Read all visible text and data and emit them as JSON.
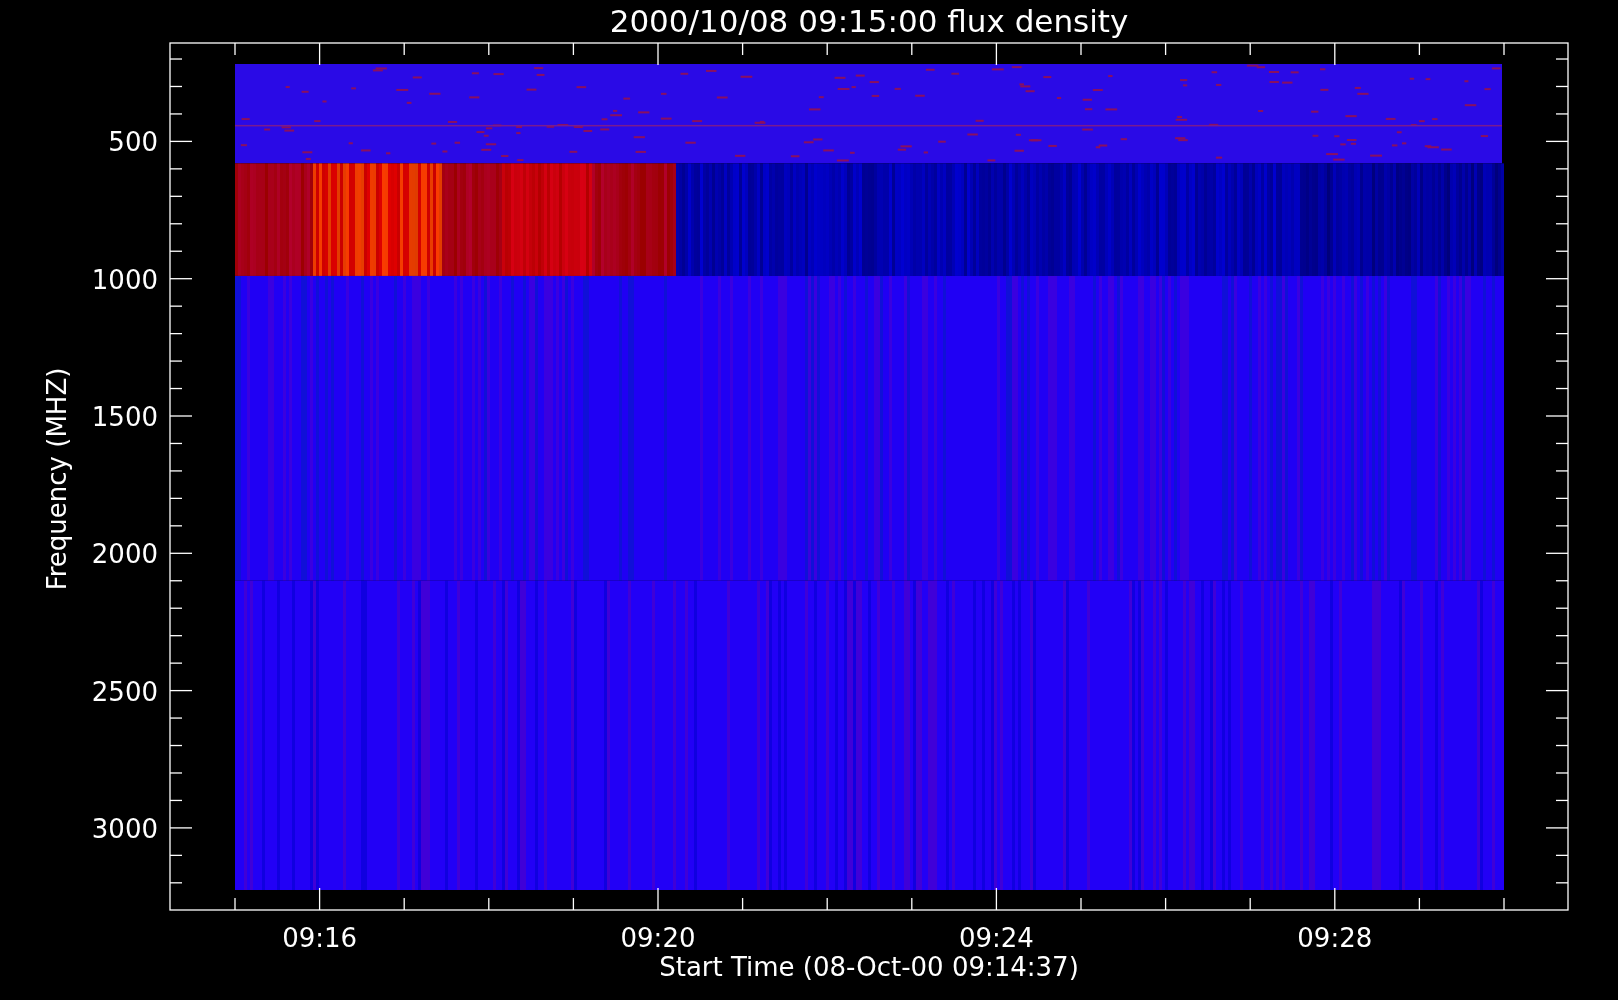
{
  "title": "2000/10/08 09:15:00 flux density",
  "plot": {
    "ylabel": "Frequency (MHZ)",
    "yticks": [
      "500",
      "1000",
      "1500",
      "2000",
      "2500",
      "3000"
    ],
    "xlabel": "Start Time (08-Oct-00 09:14:37)",
    "xticks": [
      "09:16",
      "09:20",
      "09:24",
      "09:28"
    ]
  }
}
